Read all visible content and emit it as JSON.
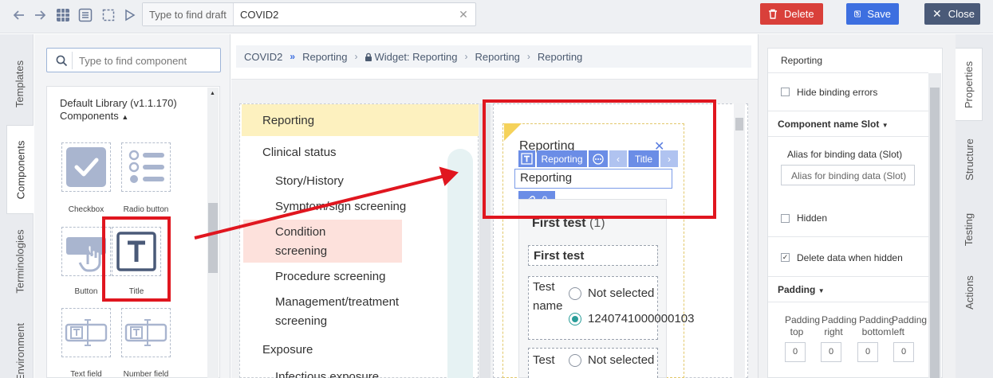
{
  "toolbar": {
    "search_placeholder": "Type to find draft",
    "search_value": "COVID2",
    "delete_label": "Delete",
    "save_label": "Save",
    "close_label": "Close"
  },
  "left_tabs": [
    "Templates",
    "Components",
    "Terminologies",
    "Environment"
  ],
  "components": {
    "search_placeholder": "Type to find component",
    "library_title": "Default Library (v1.1.170)",
    "library_subtitle": "Components",
    "items": [
      "Checkbox",
      "Radio button",
      "Button",
      "Title",
      "Text field",
      "Number field"
    ]
  },
  "breadcrumb": [
    "COVID2",
    "Reporting",
    "Widget: Reporting",
    "Reporting",
    "Reporting"
  ],
  "nav": {
    "items": [
      "Reporting",
      "Clinical status",
      "Story/History",
      "Symptom/sign screening",
      "Condition",
      "screening",
      "Procedure screening",
      "Management/treatment",
      "screening",
      "Exposure",
      "Infectious exposure"
    ]
  },
  "widget": {
    "title": "Reporting",
    "toolbar_t": "T",
    "toolbar_label": "Reporting",
    "toolbar_title": "Title",
    "input_value": "Reporting",
    "link_count": "0"
  },
  "form": {
    "section_title": "First test",
    "section_count": "(1)",
    "question_header": "First test",
    "q1_label_a": "Test",
    "q1_label_b": "name",
    "q1_opt1": "Not selected",
    "q1_opt2": "1240741000000103",
    "q2_label": "Test",
    "q2_opt1": "Not selected"
  },
  "properties": {
    "header": "Reporting",
    "hide_binding_errors": "Hide binding errors",
    "component_name_slot": "Component name Slot",
    "alias_label": "Alias for binding data (Slot)",
    "alias_placeholder": "Alias for binding data  (Slot)",
    "hidden": "Hidden",
    "delete_when_hidden": "Delete data when hidden",
    "padding": "Padding",
    "padding_top_a": "Padding",
    "padding_top_b": "top",
    "padding_right_a": "Padding",
    "padding_right_b": "right",
    "padding_bottom_a": "Padding",
    "padding_bottom_b": "bottom",
    "padding_left_a": "Padding",
    "padding_left_b": "left",
    "pad_value": "0"
  },
  "right_tabs": [
    "Properties",
    "Structure",
    "Testing",
    "Actions"
  ],
  "colors": {
    "delete": "#d9403a",
    "save": "#3d6fe0",
    "close": "#4a5a78",
    "annotation": "#e0161f"
  }
}
